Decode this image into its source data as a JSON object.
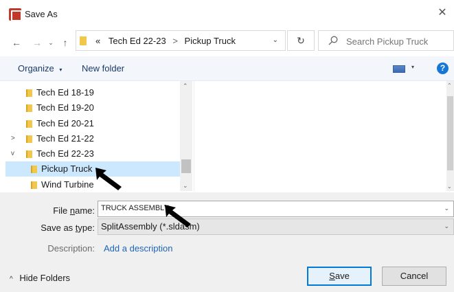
{
  "window": {
    "title": "Save As",
    "close_icon": "close-icon"
  },
  "nav": {
    "back_icon": "arrow-left-icon",
    "forward_icon": "arrow-right-icon",
    "recent_icon": "chevron-down-icon",
    "up_icon": "arrow-up-icon"
  },
  "address": {
    "overflow": "«",
    "crumbs": [
      "Tech Ed 22-23",
      "Pickup Truck"
    ],
    "separator": ">"
  },
  "search": {
    "placeholder": "Search Pickup Truck"
  },
  "toolbar": {
    "organize": "Organize",
    "new_folder": "New folder",
    "help": "?"
  },
  "tree": {
    "items": [
      {
        "label": "Tech Ed 18-19",
        "arrow": ""
      },
      {
        "label": "Tech Ed 19-20",
        "arrow": ""
      },
      {
        "label": "Tech Ed 20-21",
        "arrow": ""
      },
      {
        "label": "Tech Ed 21-22",
        "arrow": ">"
      },
      {
        "label": "Tech Ed 22-23",
        "arrow": "v"
      },
      {
        "label": "Pickup Truck",
        "arrow": "",
        "selected": true
      },
      {
        "label": "Wind Turbine",
        "arrow": ""
      }
    ]
  },
  "form": {
    "file_name_label": "File name:",
    "file_name_value": "TRUCK ASSEMBLY",
    "save_type_label": "Save as type:",
    "save_type_value": "SplitAssembly (*.sldasm)",
    "description_label": "Description:",
    "description_link": "Add a description"
  },
  "footer": {
    "hide_folders": "Hide Folders",
    "save": "Save",
    "cancel": "Cancel"
  },
  "colors": {
    "accent": "#0078d7",
    "selection": "#cce8ff",
    "link": "#1c64b8"
  }
}
